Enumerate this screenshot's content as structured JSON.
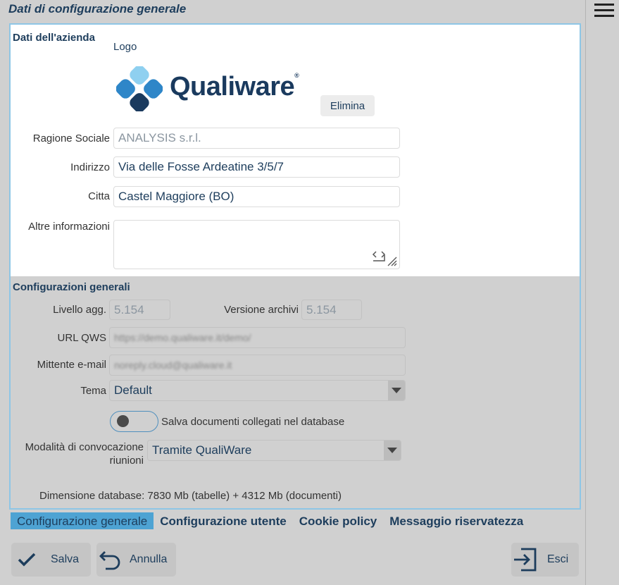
{
  "page_title": "Dati di configurazione generale",
  "company": {
    "section_title": "Dati dell'azienda",
    "logo_label": "Logo",
    "logo_text": "Qualiware",
    "logo_registered": "®",
    "delete_button": "Elimina",
    "ragione_sociale_label": "Ragione Sociale",
    "ragione_sociale_value": "ANALYSIS s.r.l.",
    "indirizzo_label": "Indirizzo",
    "indirizzo_value": "Via delle Fosse Ardeatine 3/5/7",
    "citta_label": "Citta",
    "citta_value": "Castel Maggiore (BO)",
    "altre_label": "Altre informazioni",
    "altre_value": ""
  },
  "general": {
    "section_title": "Configurazioni generali",
    "livello_label": "Livello agg.",
    "livello_value": "5.154",
    "versione_label": "Versione archivi",
    "versione_value": "5.154",
    "url_label": "URL QWS",
    "url_value": "https://demo.qualiware.it/demo/",
    "mittente_label": "Mittente e-mail",
    "mittente_value": "noreply.cloud@qualiware.it",
    "tema_label": "Tema",
    "tema_value": "Default",
    "salva_toggle_label": "Salva documenti collegati nel database",
    "salva_toggle_on": false,
    "convocazione_label_1": "Modalità di convocazione",
    "convocazione_label_2": "riunioni",
    "convocazione_value": "Tramite QualiWare",
    "db_size": "Dimensione database: 7830 Mb (tabelle) + 4312 Mb (documenti)"
  },
  "tabs": [
    {
      "label": "Configurazione generale",
      "active": true
    },
    {
      "label": "Configurazione utente",
      "active": false
    },
    {
      "label": "Cookie policy",
      "active": false
    },
    {
      "label": "Messaggio riservatezza",
      "active": false
    }
  ],
  "actions": {
    "save_label": "Salva",
    "cancel_label": "Annulla",
    "exit_label": "Esci"
  },
  "colors": {
    "accent": "#4ea3d3",
    "text_dark": "#1d3d5c",
    "logo_dark": "#1a3a5e",
    "logo_blue": "#2e86c8",
    "logo_light": "#8fd0f0"
  },
  "icons": {
    "menu": "hamburger-icon",
    "save": "check-icon",
    "cancel": "undo-icon",
    "exit": "exit-icon",
    "resize": "resize-handle-icon",
    "code": "code-icon",
    "dropdown": "chevron-down-icon"
  }
}
